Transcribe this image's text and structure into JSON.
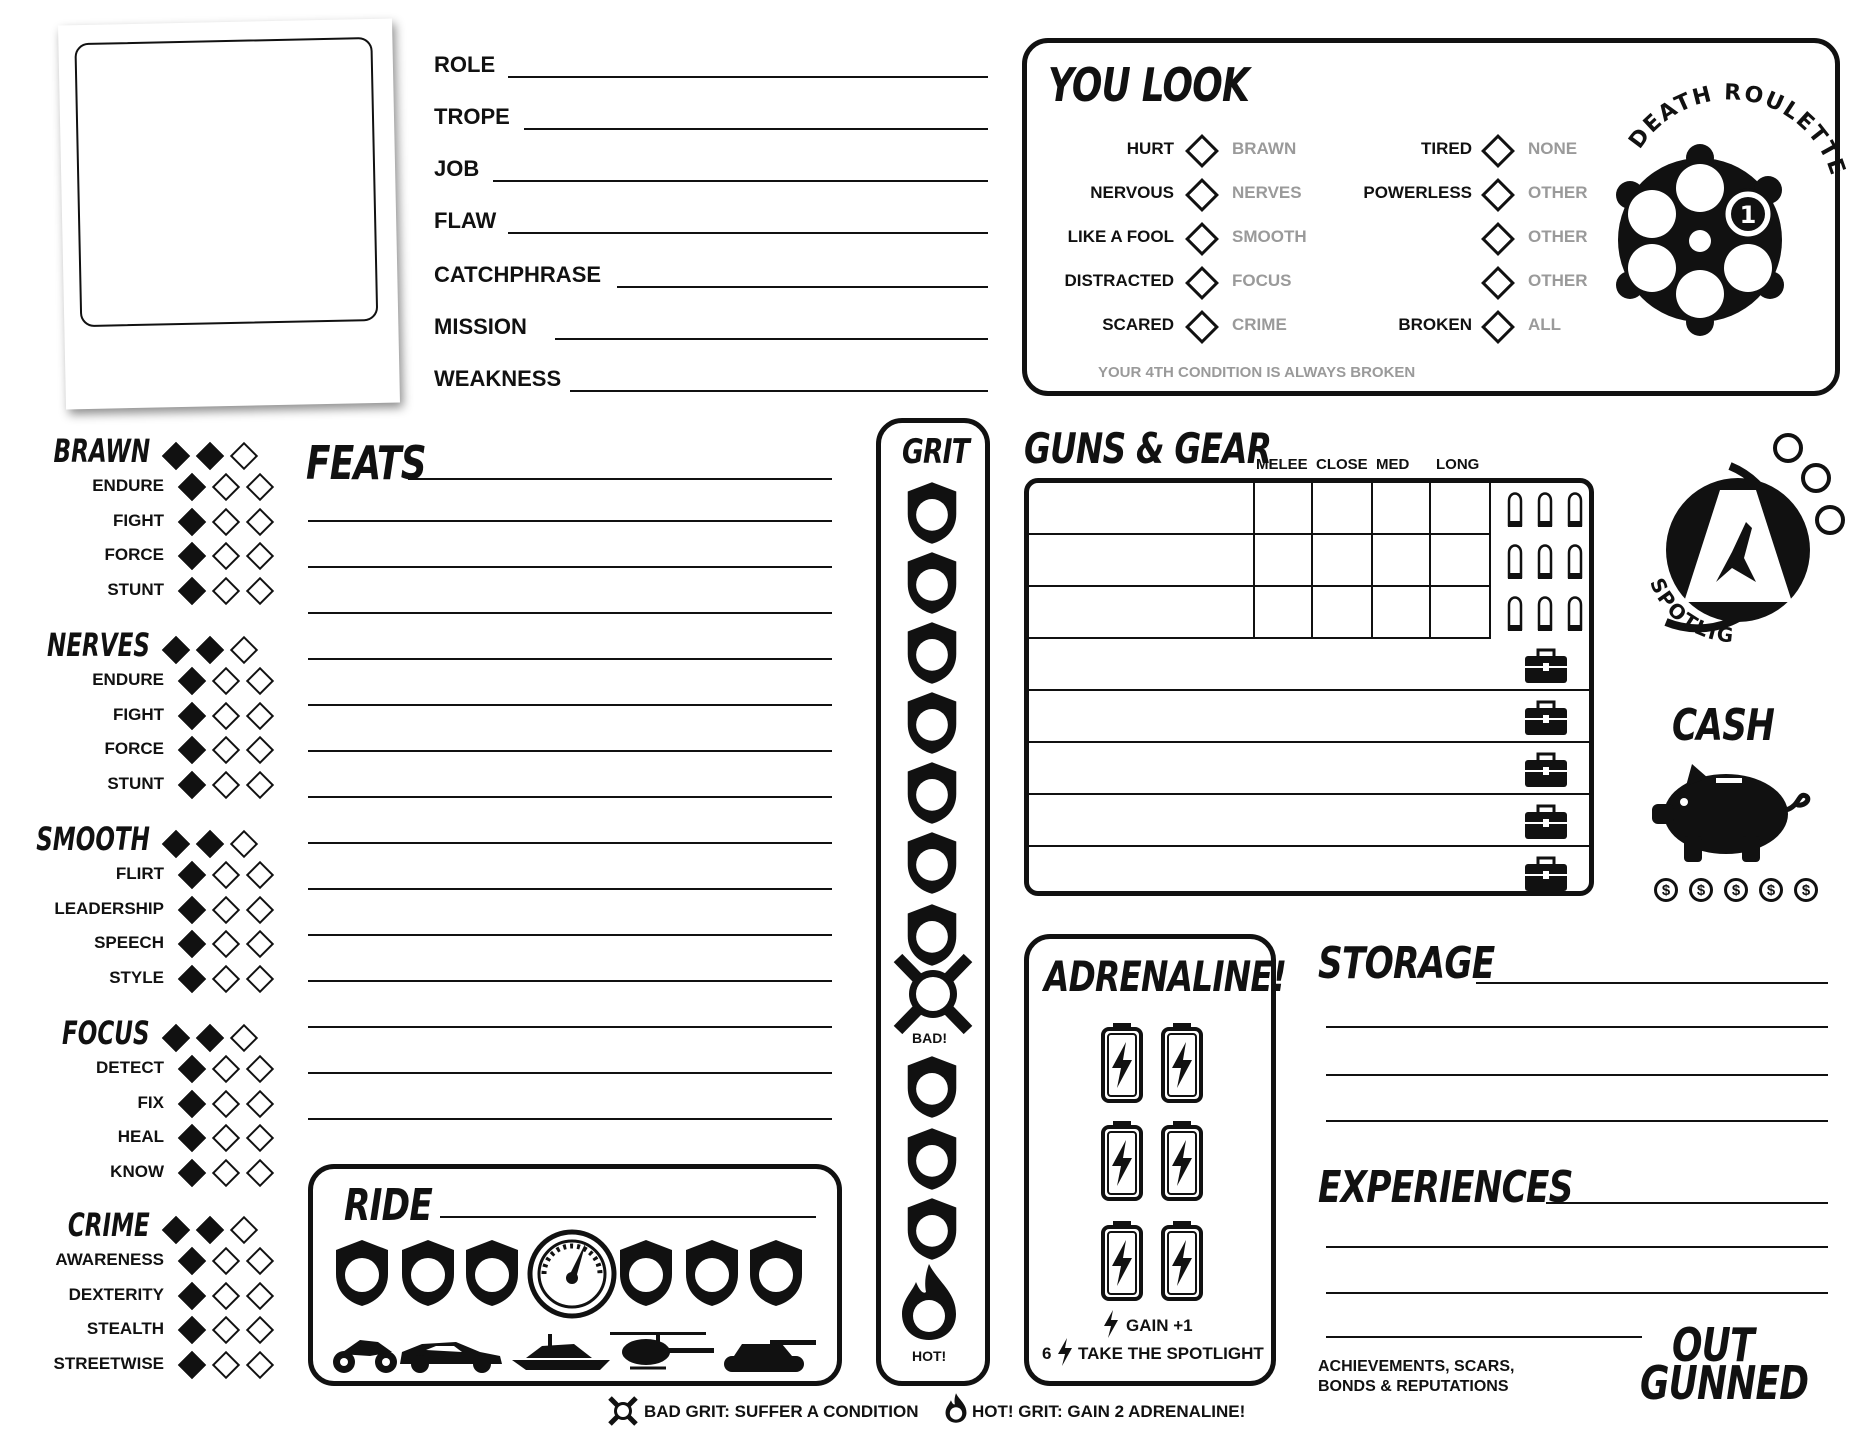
{
  "identity": {
    "fields": [
      "ROLE",
      "TROPE",
      "JOB",
      "FLAW",
      "CATCHPHRASE",
      "MISSION",
      "WEAKNESS"
    ]
  },
  "you_look": {
    "title": "YOU LOOK",
    "left": [
      {
        "c": "HURT",
        "a": "BRAWN"
      },
      {
        "c": "NERVOUS",
        "a": "NERVES"
      },
      {
        "c": "LIKE A FOOL",
        "a": "SMOOTH"
      },
      {
        "c": "DISTRACTED",
        "a": "FOCUS"
      },
      {
        "c": "SCARED",
        "a": "CRIME"
      }
    ],
    "right": [
      {
        "c": "TIRED",
        "a": "NONE"
      },
      {
        "c": "POWERLESS",
        "a": "OTHER"
      },
      {
        "c": "",
        "a": "OTHER"
      },
      {
        "c": "",
        "a": "OTHER"
      },
      {
        "c": "BROKEN",
        "a": "ALL"
      }
    ],
    "note": "YOUR 4TH CONDITION IS ALWAYS BROKEN",
    "roulette_label": "DEATH ROULETTE",
    "roulette_number": "1"
  },
  "attributes": [
    {
      "name": "BRAWN",
      "skills": [
        "ENDURE",
        "FIGHT",
        "FORCE",
        "STUNT"
      ]
    },
    {
      "name": "NERVES",
      "skills": [
        "ENDURE",
        "FIGHT",
        "FORCE",
        "STUNT"
      ]
    },
    {
      "name": "SMOOTH",
      "skills": [
        "FLIRT",
        "LEADERSHIP",
        "SPEECH",
        "STYLE"
      ]
    },
    {
      "name": "FOCUS",
      "skills": [
        "DETECT",
        "FIX",
        "HEAL",
        "KNOW"
      ]
    },
    {
      "name": "CRIME",
      "skills": [
        "AWARENESS",
        "DEXTERITY",
        "STEALTH",
        "STREETWISE"
      ]
    }
  ],
  "feats": {
    "title": "FEATS"
  },
  "grit": {
    "title": "GRIT",
    "bad": "BAD!",
    "hot": "HOT!"
  },
  "guns": {
    "title": "GUNS & GEAR",
    "columns": [
      "MELEE",
      "CLOSE",
      "MED",
      "LONG"
    ]
  },
  "spotlight": {
    "label": "SPOTLIGHT"
  },
  "cash": {
    "title": "CASH",
    "symbol": "$"
  },
  "adrenaline": {
    "title": "ADRENALINE!",
    "gain": "GAIN +1",
    "spot_num": "6",
    "spot": "TAKE THE SPOTLIGHT"
  },
  "ride": {
    "title": "RIDE"
  },
  "storage": {
    "title": "STORAGE"
  },
  "experiences": {
    "title": "EXPERIENCES",
    "note1": "ACHIEVEMENTS, SCARS,",
    "note2": "BONDS & REPUTATIONS"
  },
  "footer": {
    "bad": "BAD GRIT: SUFFER A CONDITION",
    "hot": "HOT! GRIT: GAIN 2 ADRENALINE!"
  },
  "logo": {
    "line1": "OUT",
    "line2": "GUNNED"
  }
}
